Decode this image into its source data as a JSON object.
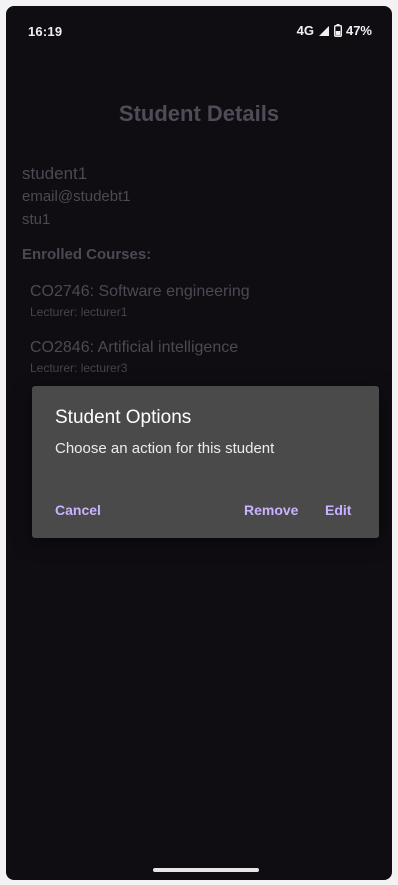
{
  "status_bar": {
    "time": "16:19",
    "network": "4G",
    "battery": "47%"
  },
  "page": {
    "title": "Student Details"
  },
  "student": {
    "name": "student1",
    "email": "email@studebt1",
    "username": "stu1"
  },
  "courses_section": {
    "label": "Enrolled Courses:",
    "items": [
      {
        "title": "CO2746: Software engineering",
        "lecturer": "Lecturer: lecturer1"
      },
      {
        "title": "CO2846: Artificial intelligence",
        "lecturer": "Lecturer: lecturer3"
      }
    ]
  },
  "dialog": {
    "title": "Student Options",
    "message": "Choose an action for this student",
    "cancel_label": "Cancel",
    "remove_label": "Remove",
    "edit_label": "Edit"
  },
  "colors": {
    "accent": "#c9b2ff",
    "background": "#0f0d12",
    "dialog_background": "#4a4a4a"
  }
}
